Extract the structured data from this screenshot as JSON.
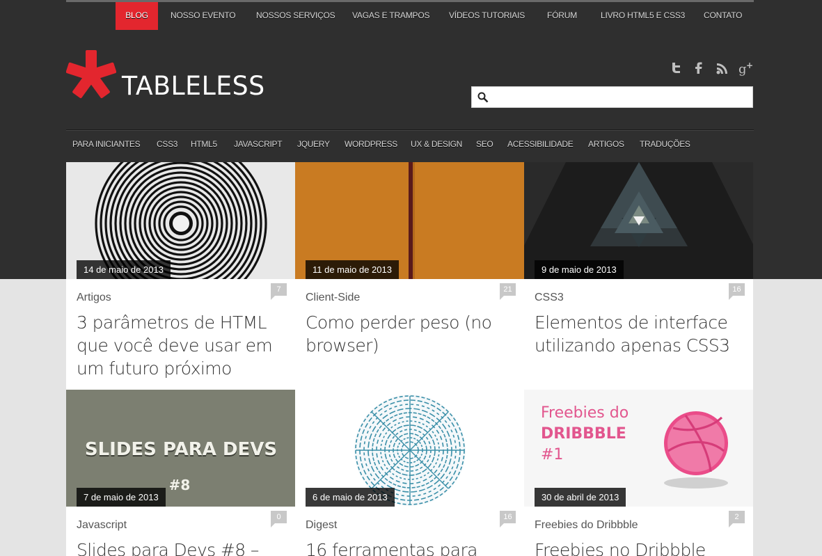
{
  "topnav": {
    "items": [
      "Blog",
      "Nosso Evento",
      "Nossos Serviços",
      "Vagas e Trampos",
      "Vídeos Tutoriais",
      "Fórum",
      "Livro HTML5 e CSS3",
      "Contato"
    ],
    "active": "Blog"
  },
  "brand": {
    "name": "TABLELESS",
    "accent": "#e3262e"
  },
  "social": [
    "twitter-icon",
    "facebook-icon",
    "rss-icon",
    "google-plus-icon"
  ],
  "search": {
    "placeholder": "",
    "value": ""
  },
  "categories": [
    "Para Iniciantes",
    "CSS3",
    "HTML5",
    "Javascript",
    "jQuery",
    "Wordpress",
    "UX & Design",
    "SEO",
    "Acessibilidade",
    "Artigos",
    "Traduções"
  ],
  "posts": [
    {
      "date": "14 de maio de 2013",
      "category": "Artigos",
      "comments": "7",
      "title": "3 parâmetros de HTML que você deve usar em um futuro próximo",
      "thumb": "concentric-circles"
    },
    {
      "date": "11 de maio de 2013",
      "category": "Client-Side",
      "comments": "21",
      "title": "Como perder peso (no browser)",
      "thumb": "orange-stripe"
    },
    {
      "date": "9 de maio de 2013",
      "category": "CSS3",
      "comments": "16",
      "title": "Elementos de interface utilizando apenas CSS3",
      "thumb": "triangles"
    },
    {
      "date": "7 de maio de 2013",
      "category": "Javascript",
      "comments": "0",
      "title": "Slides para Devs #8 –",
      "thumb": "slides",
      "thumb_text": [
        "SLIDES PARA DEVS",
        "#8"
      ]
    },
    {
      "date": "6 de maio de 2013",
      "category": "Digest",
      "comments": "16",
      "title": "16 ferramentas para",
      "thumb": "maze-circle"
    },
    {
      "date": "30 de abril de 2013",
      "category": "Freebies do Dribbble",
      "comments": "2",
      "title": "Freebies no Dribbble",
      "thumb": "dribbble",
      "thumb_text": [
        "Freebies do",
        "DRIBBBLE",
        "#1"
      ]
    }
  ]
}
